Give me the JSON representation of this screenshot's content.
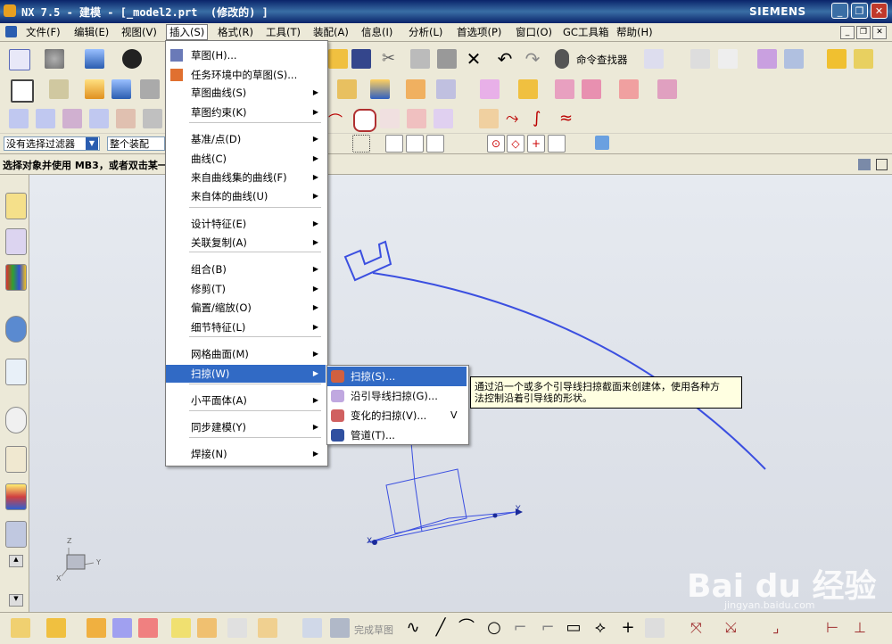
{
  "window": {
    "title": "NX 7.5 - 建模 - [_model2.prt  (修改的) ]",
    "brand": "SIEMENS"
  },
  "menubar": {
    "items": [
      "文件(F)",
      "编辑(E)",
      "视图(V)",
      "插入(S)",
      "格式(R)",
      "工具(T)",
      "装配(A)",
      "信息(I)",
      "分析(L)",
      "首选项(P)",
      "窗口(O)",
      "GC工具箱",
      "帮助(H)"
    ],
    "active": "插入(S)"
  },
  "toolbar": {
    "command_finder": "命令查找器",
    "finish_sketch": "完成草图"
  },
  "selection": {
    "filter": "没有选择过滤器",
    "scope": "整个装配"
  },
  "status": {
    "message": "选择对象并使用 MB3，或者双击某一对象"
  },
  "insert_menu": {
    "items": [
      {
        "label": "草图(H)...",
        "arrow": false
      },
      {
        "label": "任务环境中的草图(S)...",
        "arrow": false
      },
      {
        "label": "草图曲线(S)",
        "arrow": true
      },
      {
        "label": "草图约束(K)",
        "arrow": true
      },
      {
        "label": "基准/点(D)",
        "arrow": true
      },
      {
        "label": "曲线(C)",
        "arrow": true
      },
      {
        "label": "来自曲线集的曲线(F)",
        "arrow": true
      },
      {
        "label": "来自体的曲线(U)",
        "arrow": true
      },
      {
        "label": "设计特征(E)",
        "arrow": true
      },
      {
        "label": "关联复制(A)",
        "arrow": true
      },
      {
        "label": "组合(B)",
        "arrow": true
      },
      {
        "label": "修剪(T)",
        "arrow": true
      },
      {
        "label": "偏置/缩放(O)",
        "arrow": true
      },
      {
        "label": "细节特征(L)",
        "arrow": true
      },
      {
        "label": "网格曲面(M)",
        "arrow": true
      },
      {
        "label": "扫掠(W)",
        "arrow": true
      },
      {
        "label": "小平面体(A)",
        "arrow": true
      },
      {
        "label": "同步建模(Y)",
        "arrow": true
      },
      {
        "label": "焊接(N)",
        "arrow": true
      }
    ]
  },
  "sweep_submenu": {
    "items": [
      {
        "label": "扫掠(S)...",
        "shortcut": ""
      },
      {
        "label": "沿引导线扫掠(G)...",
        "shortcut": ""
      },
      {
        "label": "变化的扫掠(V)...",
        "shortcut": "V"
      },
      {
        "label": "管道(T)...",
        "shortcut": ""
      }
    ]
  },
  "tooltip": {
    "line1": "通过沿一个或多个引导线扫掠截面来创建体，使用各种方",
    "line2": "法控制沿着引导线的形状。"
  },
  "canvas": {
    "axis_x": "X",
    "axis_y": "Y",
    "axis_z": "Z"
  },
  "watermark": {
    "text": "Bai du 经验",
    "url": "jingyan.baidu.com"
  },
  "colors": {
    "curve": "#3b4fe0",
    "highlight": "#316ac5",
    "titlebar": "#0a246a"
  }
}
